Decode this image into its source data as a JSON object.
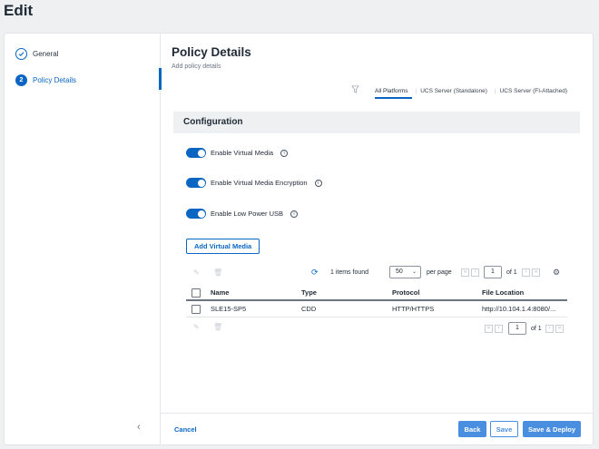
{
  "page": {
    "title": "Edit"
  },
  "sidebar": {
    "steps": [
      {
        "label": "General",
        "icon": "check-icon"
      },
      {
        "label": "Policy Details",
        "number": "2"
      }
    ],
    "collapse_icon": "chevron-left-icon"
  },
  "main": {
    "title": "Policy Details",
    "subtitle": "Add policy details",
    "filter_icon": "filter-icon",
    "tabs": [
      "All Platforms",
      "UCS Server (Standalone)",
      "UCS Server (FI-Attached)"
    ],
    "section_title": "Configuration",
    "toggles": [
      {
        "label": "Enable Virtual Media",
        "on": true
      },
      {
        "label": "Enable Virtual Media Encryption",
        "on": true
      },
      {
        "label": "Enable Low Power USB",
        "on": true
      }
    ],
    "add_button": "Add Virtual Media"
  },
  "table": {
    "items_found": "1 items found",
    "per_page_value": "50",
    "per_page_label": "per page",
    "page_value": "1",
    "of_label": "of 1",
    "columns": [
      "Name",
      "Type",
      "Protocol",
      "File Location"
    ],
    "rows": [
      [
        "SLE15-SP5",
        "CDD",
        "HTTP/HTTPS",
        "http://10.104.1.4:8080/..."
      ]
    ],
    "bottom_page_value": "1",
    "bottom_of_label": "of 1"
  },
  "footer": {
    "cancel": "Cancel",
    "back": "Back",
    "save": "Save",
    "save_deploy": "Save & Deploy"
  },
  "colors": {
    "accent": "#0a66c2",
    "button": "#4a8ee0"
  }
}
